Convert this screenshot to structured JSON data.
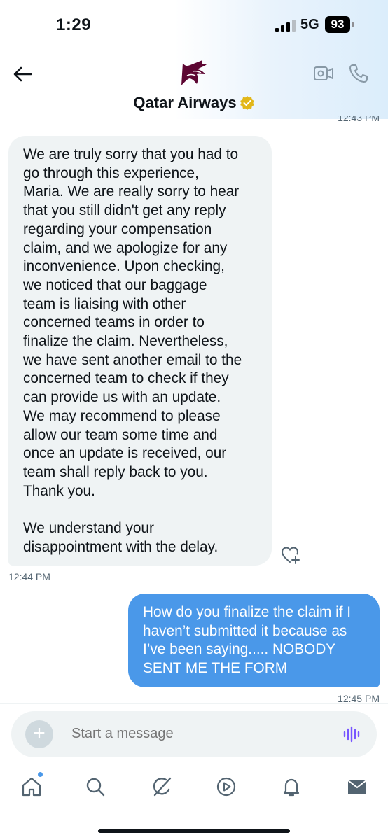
{
  "status_bar": {
    "time": "1:29",
    "network": "5G",
    "battery": "93"
  },
  "header": {
    "title": "Qatar Airways",
    "verified_color": "#e2b719",
    "brand_color": "#5c0632"
  },
  "conversation": {
    "previous_timestamp": "12:43 PM",
    "messages": [
      {
        "direction": "incoming",
        "text": "We are truly sorry that you had to\ngo through this experience,\nMaria. We are really sorry to hear\nthat you still didn't get any reply\nregarding your compensation\nclaim, and we apologize for any\ninconvenience. Upon checking,\nwe noticed that our baggage\nteam is liaising with other\nconcerned teams in order to\nfinalize the claim. Nevertheless,\nwe have sent another email to the\nconcerned team to check if they\ncan provide us with an update.\nWe may recommend to please\nallow our team some time and\nonce an update is received, our\nteam shall reply back to you.\nThank you.\n\nWe understand your\ndisappointment with the delay.",
        "timestamp": "12:44 PM"
      },
      {
        "direction": "outgoing",
        "text": "How do you finalize the claim if I\nhaven’t submitted it because as\nI’ve been saying..... NOBODY\nSENT ME THE FORM",
        "timestamp": "12:45 PM"
      }
    ]
  },
  "composer": {
    "placeholder": "Start a message",
    "accent_color": "#7856ff"
  },
  "tab_bar": {
    "items": [
      "home-icon",
      "search-icon",
      "grok-icon",
      "video-icon",
      "notifications-icon",
      "messages-icon"
    ],
    "active": "messages-icon"
  }
}
